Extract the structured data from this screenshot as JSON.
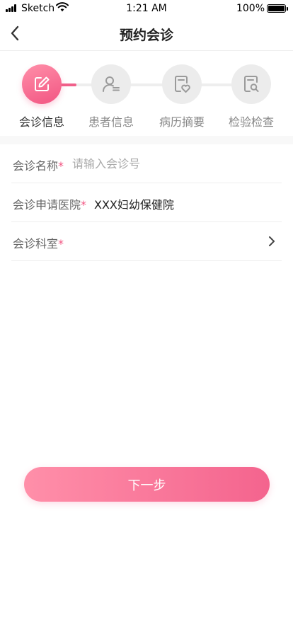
{
  "status_bar": {
    "carrier": "Sketch",
    "time": "1:21 AM",
    "battery": "100%"
  },
  "nav": {
    "title": "预约会诊"
  },
  "steps": [
    {
      "label": "会诊信息",
      "icon": "edit-icon",
      "active": true
    },
    {
      "label": "患者信息",
      "icon": "user-list-icon",
      "active": false
    },
    {
      "label": "病历摘要",
      "icon": "record-heart-icon",
      "active": false
    },
    {
      "label": "检验检查",
      "icon": "document-search-icon",
      "active": false
    }
  ],
  "form": {
    "consult_name": {
      "label": "会诊名称",
      "required": "*",
      "placeholder": "请输入会诊号",
      "value": ""
    },
    "hospital": {
      "label": "会诊申请医院",
      "required": "*",
      "value": "XXX妇幼保健院"
    },
    "department": {
      "label": "会诊科室",
      "required": "*",
      "value": ""
    }
  },
  "next_button": {
    "label": "下一步"
  },
  "colors": {
    "accent": "#f25582",
    "accent_light": "#ff8fa9",
    "inactive_step": "#ececec"
  }
}
